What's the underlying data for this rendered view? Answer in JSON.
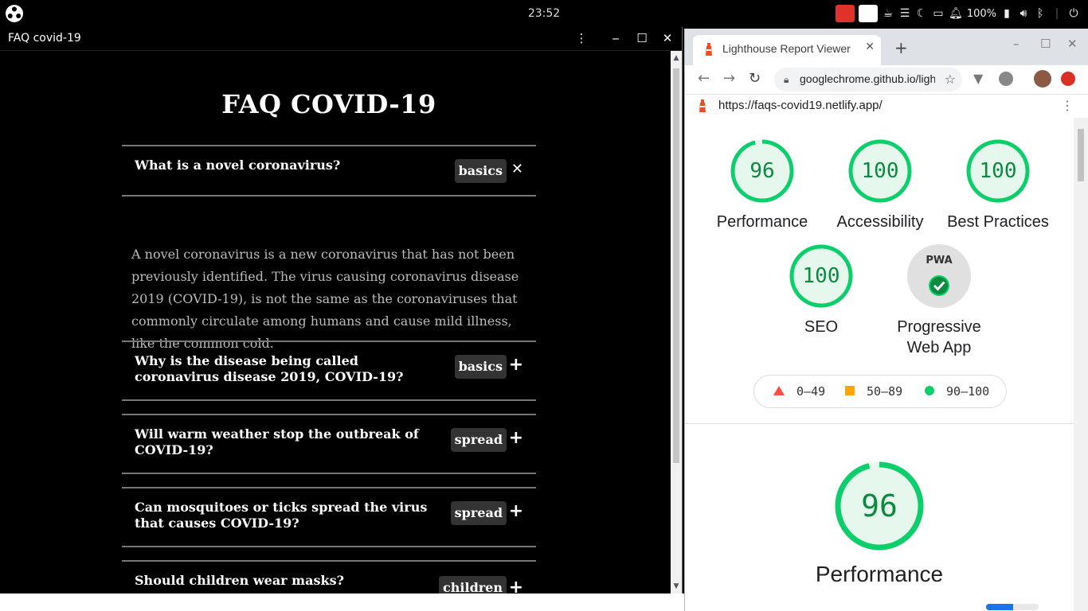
{
  "system": {
    "clock": "23:52",
    "battery": "100%"
  },
  "faq_window": {
    "title": "FAQ covid-19",
    "heading": "FAQ COVID-19",
    "items": [
      {
        "question": "What is a novel coronavirus?",
        "tag": "basics",
        "toggle": "✕",
        "expanded": true,
        "answer": "A novel coronavirus is a new coronavirus that has not been previously identified. The virus causing coronavirus disease 2019 (COVID-19), is not the same as the coronaviruses that commonly circulate among humans and cause mild illness, like the common cold."
      },
      {
        "question": "Why is the disease being called coronavirus disease 2019, COVID-19?",
        "tag": "basics",
        "toggle": "+"
      },
      {
        "question": "Will warm weather stop the outbreak of COVID-19?",
        "tag": "spread",
        "toggle": "+"
      },
      {
        "question": "Can mosquitoes or ticks spread the virus that causes COVID-19?",
        "tag": "spread",
        "toggle": "+"
      },
      {
        "question": "Should children wear masks?",
        "tag": "children",
        "toggle": "+"
      }
    ]
  },
  "browser": {
    "tab_title": "Lighthouse Report Viewer",
    "omnibox_url": "googlechrome.github.io/lighthouse/viewer/",
    "page_url": "https://faqs-covid19.netlify.app/",
    "scores": [
      {
        "label": "Performance",
        "score": 96
      },
      {
        "label": "Accessibility",
        "score": 100
      },
      {
        "label": "Best Practices",
        "score": 100
      },
      {
        "label": "SEO",
        "score": 100
      }
    ],
    "pwa": {
      "label_line1": "Progressive",
      "label_line2": "Web App",
      "badge": "PWA"
    },
    "legend": {
      "fail": "0–49",
      "average": "50–89",
      "pass": "90–100"
    },
    "big_score": {
      "score": 96,
      "label": "Performance"
    },
    "colors": {
      "pass": "#0cce6b",
      "pass_text": "#0b8a40",
      "fail": "#ff4e42",
      "average": "#ffa400"
    }
  }
}
